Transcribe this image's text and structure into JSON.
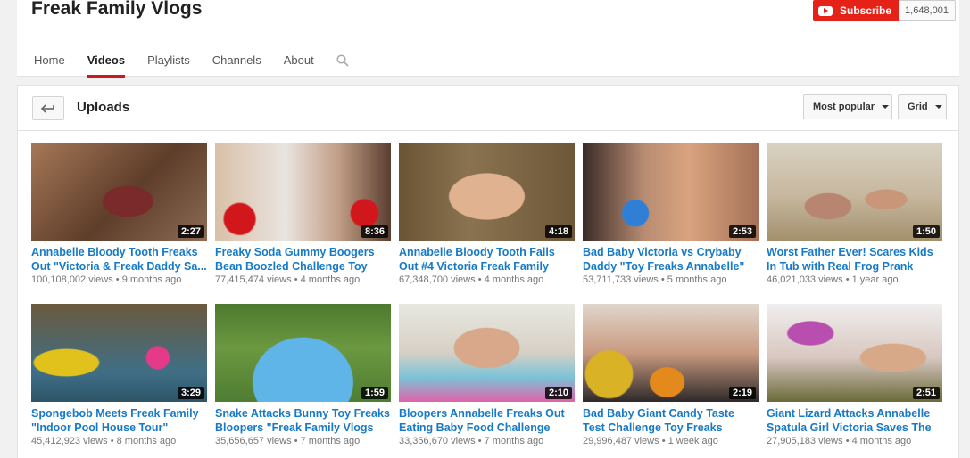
{
  "channel": {
    "title": "Freak Family Vlogs",
    "subscribe_label": "Subscribe",
    "subscriber_count": "1,648,001"
  },
  "tabs": [
    {
      "label": "Home"
    },
    {
      "label": "Videos"
    },
    {
      "label": "Playlists"
    },
    {
      "label": "Channels"
    },
    {
      "label": "About"
    }
  ],
  "toolbar": {
    "title": "Uploads",
    "sort_label": "Most popular",
    "view_label": "Grid"
  },
  "videos": [
    {
      "title": "Annabelle Bloody Tooth Freaks Out \"Victoria & Freak Daddy Sa...",
      "views": "100,108,002 views",
      "age": "9 months ago",
      "duration": "2:27"
    },
    {
      "title": "Freaky Soda Gummy Boogers Bean Boozled Challenge Toy",
      "views": "77,415,474 views",
      "age": "4 months ago",
      "duration": "8:36"
    },
    {
      "title": "Annabelle Bloody Tooth Falls Out #4 Victoria Freak Family Vlogs",
      "views": "67,348,700 views",
      "age": "4 months ago",
      "duration": "4:18"
    },
    {
      "title": "Bad Baby Victoria vs Crybaby Daddy \"Toy Freaks Annabelle\"",
      "views": "53,711,733 views",
      "age": "5 months ago",
      "duration": "2:53"
    },
    {
      "title": "Worst Father Ever! Scares Kids In Tub with Real Frog Prank gone",
      "views": "46,021,033 views",
      "age": "1 year ago",
      "duration": "1:50"
    },
    {
      "title": "Spongebob Meets Freak Family \"Indoor Pool House Tour\"",
      "views": "45,412,923 views",
      "age": "8 months ago",
      "duration": "3:29"
    },
    {
      "title": "Snake Attacks Bunny Toy Freaks Bloopers \"Freak Family Vlogs",
      "views": "35,656,657 views",
      "age": "7 months ago",
      "duration": "1:59"
    },
    {
      "title": "Bloopers Annabelle Freaks Out Eating Baby Food Challenge Style",
      "views": "33,356,670 views",
      "age": "7 months ago",
      "duration": "2:10"
    },
    {
      "title": "Bad Baby Giant Candy Taste Test Challenge Toy Freaks Family",
      "views": "29,996,487 views",
      "age": "1 week ago",
      "duration": "2:19"
    },
    {
      "title": "Giant Lizard Attacks Annabelle Spatula Girl Victoria Saves The",
      "views": "27,905,183 views",
      "age": "4 months ago",
      "duration": "2:51"
    }
  ],
  "meta_separator": "•",
  "icons": {
    "search": "search-icon",
    "back": "back-arrow-icon",
    "dropdown": "chevron-down-icon",
    "youtube": "youtube-logo-icon"
  },
  "colors": {
    "subscribe": "#e62117",
    "link": "#167ac6",
    "active_tab": "#cc181e"
  }
}
